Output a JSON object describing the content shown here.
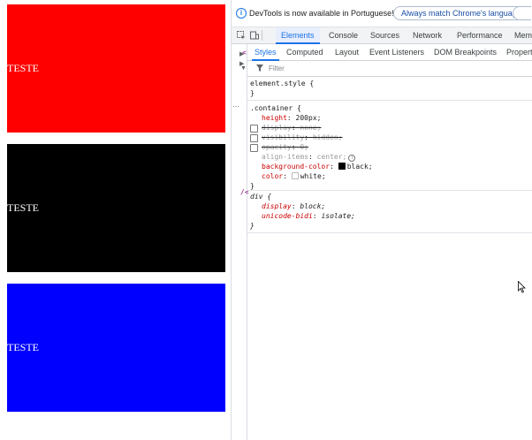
{
  "page": {
    "boxes": [
      {
        "text": "TESTE",
        "bg": "#ff0000"
      },
      {
        "text": "TESTE",
        "bg": "#000000"
      },
      {
        "text": "TESTE",
        "bg": "#0000ff"
      }
    ]
  },
  "devtools": {
    "notice": {
      "text": "DevTools is now available in Portuguese!",
      "button": "Always match Chrome's language"
    },
    "main_tabs": [
      "Elements",
      "Console",
      "Sources",
      "Network",
      "Performance",
      "Mem"
    ],
    "active_main_tab": "Elements",
    "sub_tabs": [
      "Styles",
      "Computed",
      "Layout",
      "Event Listeners",
      "DOM Breakpoints",
      "Propert"
    ],
    "active_sub_tab": "Styles",
    "filter_placeholder": "Filter",
    "strip_labels": [
      "<",
      "/<"
    ],
    "element_style": {
      "selector": "element.style {",
      "close": "}"
    },
    "container_rule": {
      "selector": ".container {",
      "decls": [
        {
          "prop": "height",
          "value": "200px;"
        },
        {
          "prop": "display",
          "value": "none;"
        },
        {
          "prop": "visibility",
          "value": "hidden;"
        },
        {
          "prop": "opacity",
          "value": "0;"
        },
        {
          "prop": "align-items",
          "value": "center;"
        },
        {
          "prop": "background-color",
          "value": "black;",
          "swatch": "#000000"
        },
        {
          "prop": "color",
          "value": "white;",
          "swatch": "#ffffff"
        }
      ],
      "close": "}"
    },
    "ua_rule": {
      "selector": "div {",
      "decls": [
        {
          "prop": "display",
          "value": "block;"
        },
        {
          "prop": "unicode-bidi",
          "value": "isolate;"
        }
      ],
      "close": "}"
    }
  }
}
